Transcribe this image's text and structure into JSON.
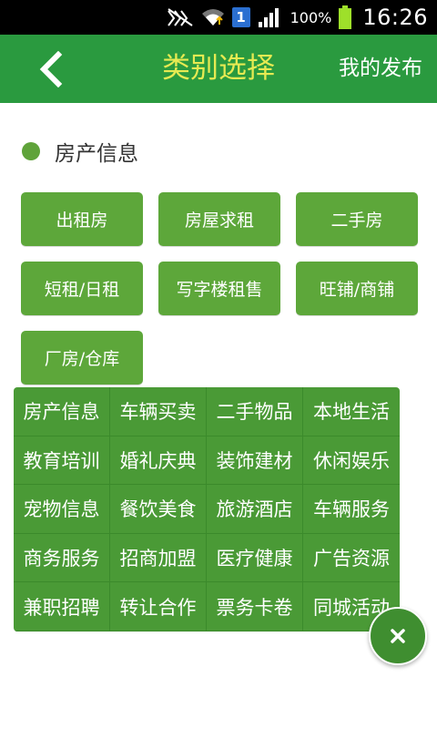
{
  "status_bar": {
    "battery_percent": "100%",
    "time": "16:26",
    "sim_label": "1",
    "icons": [
      "mute-icon",
      "wifi-icon",
      "sim-icon",
      "signal-icon",
      "battery-icon"
    ]
  },
  "header": {
    "title": "类别选择",
    "publish_label": "我的发布",
    "back_icon": "chevron-left-icon"
  },
  "section": {
    "title": "房产信息"
  },
  "subcategories": [
    "出租房",
    "房屋求租",
    "二手房",
    "短租/日租",
    "写字楼租售",
    "旺铺/商铺",
    "厂房/仓库"
  ],
  "category_menu": [
    "房产信息",
    "车辆买卖",
    "二手物品",
    "本地生活",
    "教育培训",
    "婚礼庆典",
    "装饰建材",
    "休闲娱乐",
    "宠物信息",
    "餐饮美食",
    "旅游酒店",
    "车辆服务",
    "商务服务",
    "招商加盟",
    "医疗健康",
    "广告资源",
    "兼职招聘",
    "转让合作",
    "票务卡卷",
    "同城活动"
  ],
  "colors": {
    "header_bg": "#2a9a3f",
    "title_color": "#e6ea52",
    "button_bg": "#5da73a",
    "panel_bg": "#4a9a36"
  }
}
